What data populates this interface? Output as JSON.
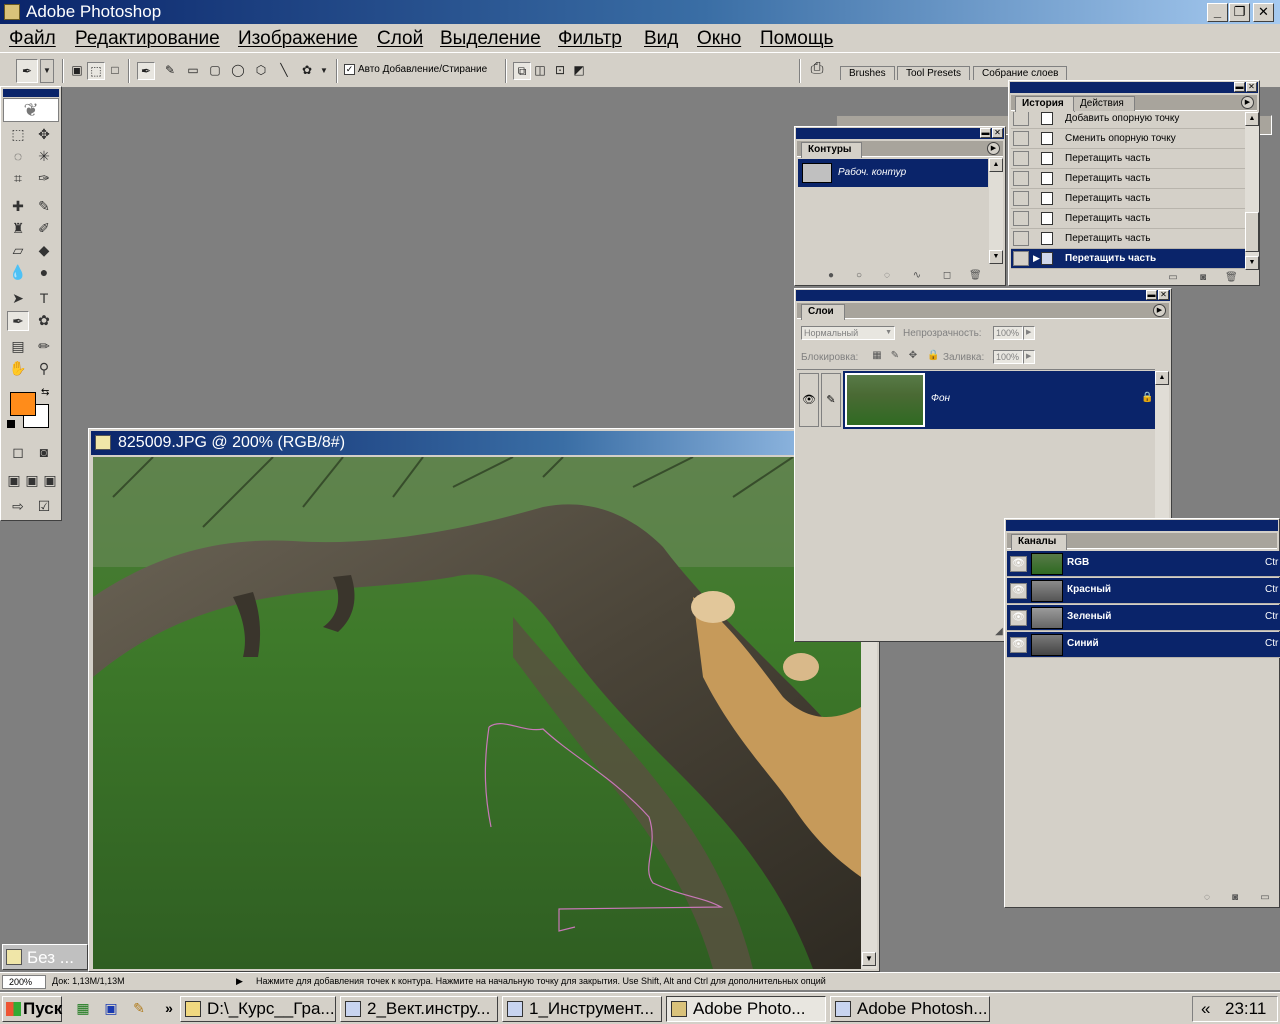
{
  "app": {
    "title": "Adobe Photoshop"
  },
  "menu": [
    "Файл",
    "Редактирование",
    "Изображение",
    "Слой",
    "Выделение",
    "Фильтр",
    "Вид",
    "Окно",
    "Помощь"
  ],
  "options": {
    "auto_add_delete": "Авто Добавление/Стирание",
    "auto_add_checked": true
  },
  "palette_well": [
    "Brushes",
    "Tool Presets",
    "Собрание слоев"
  ],
  "colors": {
    "foreground": "#ff8c1a",
    "background": "#ffffff",
    "selection": "#0a246a",
    "title_bar": "#0a246a"
  },
  "document": {
    "title": "825009.JPG @ 200% (RGB/8#)",
    "zoom": "200%",
    "doc_info": "Док: 1,13M/1,13M",
    "status_hint": "Нажмите для добавления точек к контура. Нажмите на начальную точку для закрытия.  Use Shift, Alt and Ctrl для дополнительных опций"
  },
  "paths_panel": {
    "tab": "Контуры",
    "items": [
      {
        "name": "Рабоч. контур",
        "selected": true
      }
    ]
  },
  "history_panel": {
    "tabs": [
      "История",
      "Действия"
    ],
    "items": [
      {
        "label": "Добавить опорную точку",
        "selected": false
      },
      {
        "label": "Сменить опорную точку",
        "selected": false
      },
      {
        "label": "Перетащить часть",
        "selected": false
      },
      {
        "label": "Перетащить часть",
        "selected": false
      },
      {
        "label": "Перетащить часть",
        "selected": false
      },
      {
        "label": "Перетащить часть",
        "selected": false
      },
      {
        "label": "Перетащить часть",
        "selected": false
      },
      {
        "label": "Перетащить часть",
        "selected": true
      }
    ]
  },
  "layers_panel": {
    "tab": "Слои",
    "blend_mode": "Нормальный",
    "opacity_label": "Непрозрачность:",
    "opacity_value": "100%",
    "lock_label": "Блокировка:",
    "fill_label": "Заливка:",
    "fill_value": "100%",
    "layers": [
      {
        "name": "Фон",
        "selected": true
      }
    ]
  },
  "channels_panel": {
    "tab": "Каналы",
    "channels": [
      {
        "name": "RGB",
        "shortcut": "Ctr"
      },
      {
        "name": "Красный",
        "shortcut": "Ctr"
      },
      {
        "name": "Зеленый",
        "shortcut": "Ctr"
      },
      {
        "name": "Синий",
        "shortcut": "Ctr"
      }
    ]
  },
  "minimized_doc": {
    "title": "Без ..."
  },
  "taskbar": {
    "start": "Пуск",
    "tasks": [
      {
        "label": "D:\\_Курс__Гра...",
        "active": false
      },
      {
        "label": "2_Вект.инстру...",
        "active": false
      },
      {
        "label": "1_Инструмент...",
        "active": false
      },
      {
        "label": "Adobe Photo...",
        "active": true
      },
      {
        "label": "Adobe Photosh...",
        "active": false
      }
    ],
    "tray_arrow": "«",
    "clock": "23:11"
  }
}
